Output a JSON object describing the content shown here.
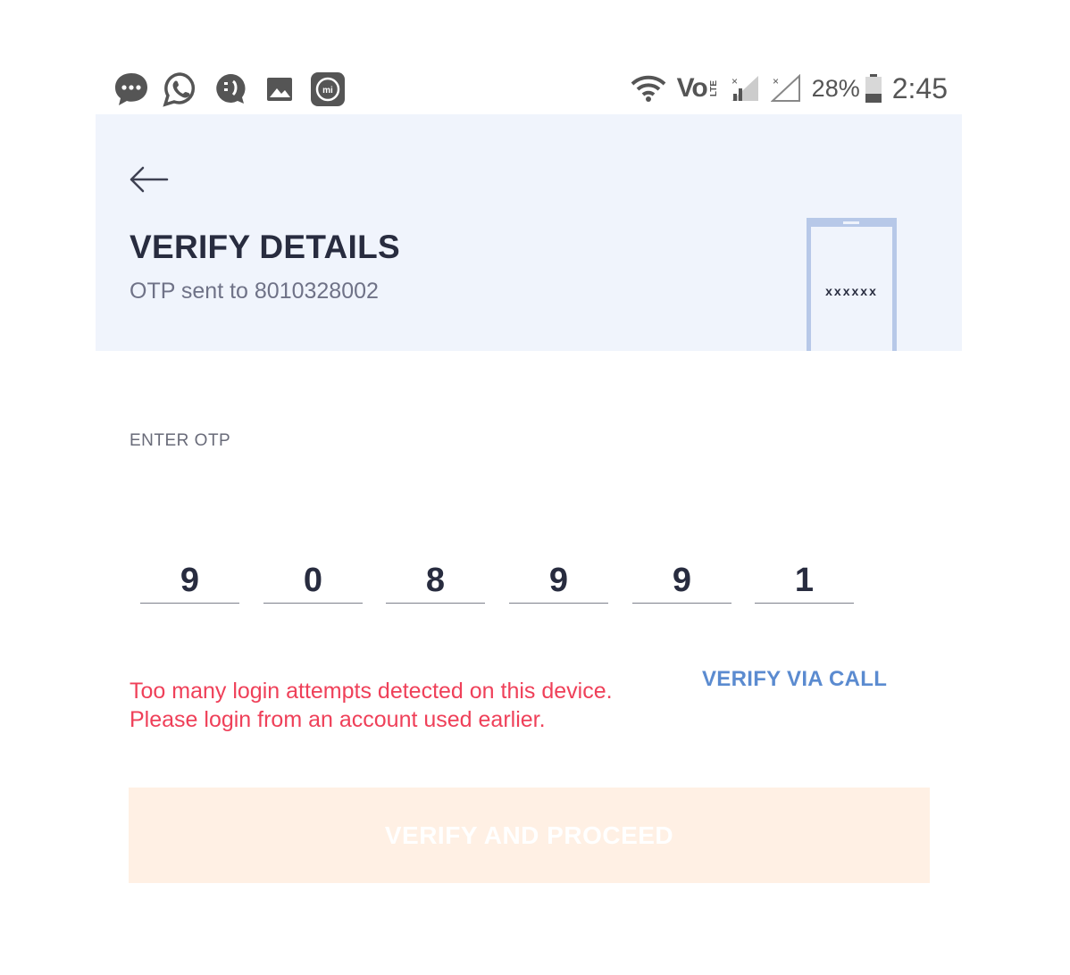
{
  "status_bar": {
    "notification_icons": [
      "messaging-icon",
      "whatsapp-icon",
      "chat-bubble-icon",
      "gallery-icon",
      "mi-app-icon"
    ],
    "battery_percent": "28%",
    "time": "2:45",
    "network_text": "Vo",
    "lte_text": "LTE"
  },
  "header": {
    "title": "VERIFY DETAILS",
    "subtitle": "OTP sent to 8010328002",
    "phone_mask": "xxxxxx"
  },
  "otp": {
    "label": "ENTER OTP",
    "digits": [
      "9",
      "0",
      "8",
      "9",
      "9",
      "1"
    ]
  },
  "error": {
    "line1": "Too many login attempts detected on this device.",
    "line2": "Please login from an account used earlier."
  },
  "verify_call_label": "VERIFY VIA CALL",
  "proceed_label": "VERIFY AND PROCEED",
  "colors": {
    "header_bg": "#f0f4fc",
    "title": "#282c3f",
    "error": "#ef4059",
    "link": "#5b8bd0",
    "proceed_bg": "#fff0e4"
  }
}
